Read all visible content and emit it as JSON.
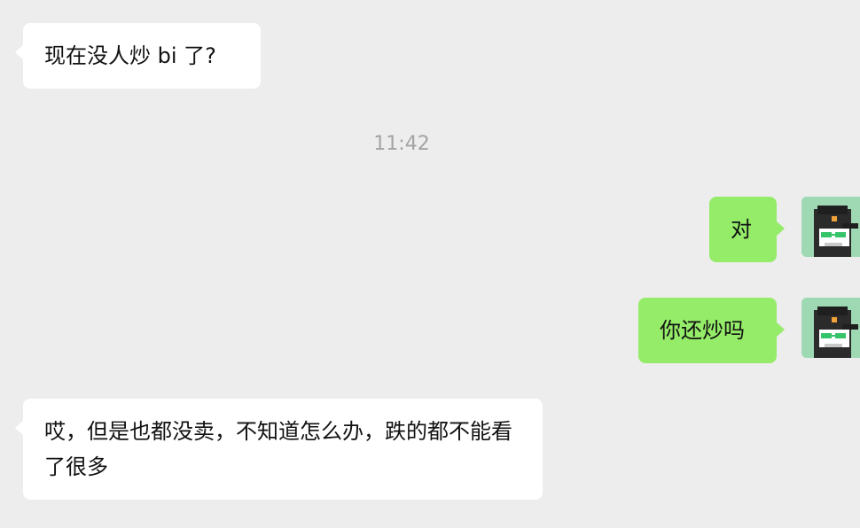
{
  "messages": [
    {
      "side": "incoming",
      "text": "现在没人炒 bi 了?"
    },
    {
      "side": "timestamp",
      "text": "11:42"
    },
    {
      "side": "outgoing",
      "text": "对"
    },
    {
      "side": "outgoing",
      "text": "你还炒吗"
    },
    {
      "side": "incoming",
      "text": "哎，但是也都没卖，不知道怎么办，跌的都不能看了很多"
    }
  ],
  "avatar": {
    "icon": "pixel-penguin-cap-avatar-icon",
    "colors": {
      "background": "#9ed9b4",
      "body": "#2b2b2b",
      "face": "#ffffff",
      "glasses": "#35c46a",
      "cap_emblem": "#f0a23a"
    }
  },
  "colors": {
    "background": "#ededed",
    "incoming_bubble": "#ffffff",
    "outgoing_bubble": "#95ec69",
    "timestamp": "#a3a3a3"
  }
}
